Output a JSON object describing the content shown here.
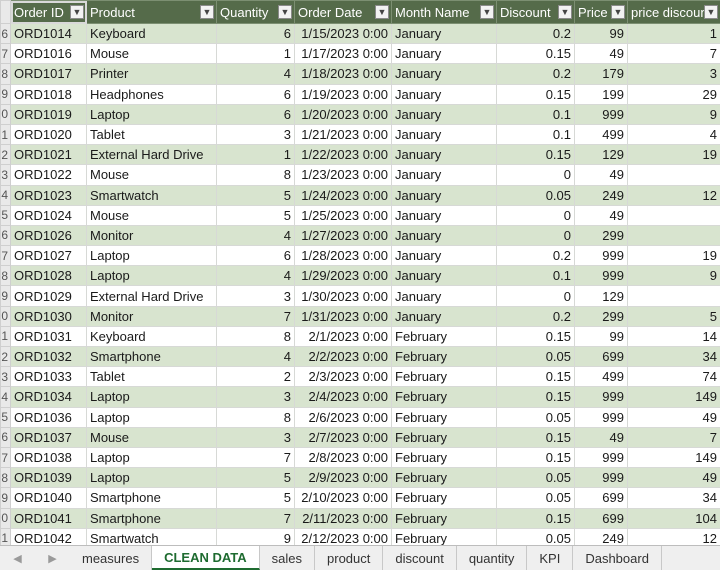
{
  "headers": [
    "Order ID",
    "Product",
    "Quantity",
    "Order Date",
    "Month Name",
    "Discount",
    "Price",
    "price discount"
  ],
  "rows": [
    {
      "rn": "6",
      "id": "ORD1014",
      "product": "Keyboard",
      "qty": "6",
      "date": "1/15/2023 0:00",
      "month": "January",
      "disc": "0.2",
      "price": "99",
      "pdisc": "1"
    },
    {
      "rn": "7",
      "id": "ORD1016",
      "product": "Mouse",
      "qty": "1",
      "date": "1/17/2023 0:00",
      "month": "January",
      "disc": "0.15",
      "price": "49",
      "pdisc": "7"
    },
    {
      "rn": "8",
      "id": "ORD1017",
      "product": "Printer",
      "qty": "4",
      "date": "1/18/2023 0:00",
      "month": "January",
      "disc": "0.2",
      "price": "179",
      "pdisc": "3"
    },
    {
      "rn": "9",
      "id": "ORD1018",
      "product": "Headphones",
      "qty": "6",
      "date": "1/19/2023 0:00",
      "month": "January",
      "disc": "0.15",
      "price": "199",
      "pdisc": "29"
    },
    {
      "rn": "0",
      "id": "ORD1019",
      "product": "Laptop",
      "qty": "6",
      "date": "1/20/2023 0:00",
      "month": "January",
      "disc": "0.1",
      "price": "999",
      "pdisc": "9"
    },
    {
      "rn": "1",
      "id": "ORD1020",
      "product": "Tablet",
      "qty": "3",
      "date": "1/21/2023 0:00",
      "month": "January",
      "disc": "0.1",
      "price": "499",
      "pdisc": "4"
    },
    {
      "rn": "2",
      "id": "ORD1021",
      "product": "External Hard Drive",
      "qty": "1",
      "date": "1/22/2023 0:00",
      "month": "January",
      "disc": "0.15",
      "price": "129",
      "pdisc": "19"
    },
    {
      "rn": "3",
      "id": "ORD1022",
      "product": "Mouse",
      "qty": "8",
      "date": "1/23/2023 0:00",
      "month": "January",
      "disc": "0",
      "price": "49",
      "pdisc": ""
    },
    {
      "rn": "4",
      "id": "ORD1023",
      "product": "Smartwatch",
      "qty": "5",
      "date": "1/24/2023 0:00",
      "month": "January",
      "disc": "0.05",
      "price": "249",
      "pdisc": "12"
    },
    {
      "rn": "5",
      "id": "ORD1024",
      "product": "Mouse",
      "qty": "5",
      "date": "1/25/2023 0:00",
      "month": "January",
      "disc": "0",
      "price": "49",
      "pdisc": ""
    },
    {
      "rn": "6",
      "id": "ORD1026",
      "product": "Monitor",
      "qty": "4",
      "date": "1/27/2023 0:00",
      "month": "January",
      "disc": "0",
      "price": "299",
      "pdisc": ""
    },
    {
      "rn": "7",
      "id": "ORD1027",
      "product": "Laptop",
      "qty": "6",
      "date": "1/28/2023 0:00",
      "month": "January",
      "disc": "0.2",
      "price": "999",
      "pdisc": "19"
    },
    {
      "rn": "8",
      "id": "ORD1028",
      "product": "Laptop",
      "qty": "4",
      "date": "1/29/2023 0:00",
      "month": "January",
      "disc": "0.1",
      "price": "999",
      "pdisc": "9"
    },
    {
      "rn": "9",
      "id": "ORD1029",
      "product": "External Hard Drive",
      "qty": "3",
      "date": "1/30/2023 0:00",
      "month": "January",
      "disc": "0",
      "price": "129",
      "pdisc": ""
    },
    {
      "rn": "0",
      "id": "ORD1030",
      "product": "Monitor",
      "qty": "7",
      "date": "1/31/2023 0:00",
      "month": "January",
      "disc": "0.2",
      "price": "299",
      "pdisc": "5"
    },
    {
      "rn": "1",
      "id": "ORD1031",
      "product": "Keyboard",
      "qty": "8",
      "date": "2/1/2023 0:00",
      "month": "February",
      "disc": "0.15",
      "price": "99",
      "pdisc": "14"
    },
    {
      "rn": "2",
      "id": "ORD1032",
      "product": "Smartphone",
      "qty": "4",
      "date": "2/2/2023 0:00",
      "month": "February",
      "disc": "0.05",
      "price": "699",
      "pdisc": "34"
    },
    {
      "rn": "3",
      "id": "ORD1033",
      "product": "Tablet",
      "qty": "2",
      "date": "2/3/2023 0:00",
      "month": "February",
      "disc": "0.15",
      "price": "499",
      "pdisc": "74"
    },
    {
      "rn": "4",
      "id": "ORD1034",
      "product": "Laptop",
      "qty": "3",
      "date": "2/4/2023 0:00",
      "month": "February",
      "disc": "0.15",
      "price": "999",
      "pdisc": "149"
    },
    {
      "rn": "5",
      "id": "ORD1036",
      "product": "Laptop",
      "qty": "8",
      "date": "2/6/2023 0:00",
      "month": "February",
      "disc": "0.05",
      "price": "999",
      "pdisc": "49"
    },
    {
      "rn": "6",
      "id": "ORD1037",
      "product": "Mouse",
      "qty": "3",
      "date": "2/7/2023 0:00",
      "month": "February",
      "disc": "0.15",
      "price": "49",
      "pdisc": "7"
    },
    {
      "rn": "7",
      "id": "ORD1038",
      "product": "Laptop",
      "qty": "7",
      "date": "2/8/2023 0:00",
      "month": "February",
      "disc": "0.15",
      "price": "999",
      "pdisc": "149"
    },
    {
      "rn": "8",
      "id": "ORD1039",
      "product": "Laptop",
      "qty": "5",
      "date": "2/9/2023 0:00",
      "month": "February",
      "disc": "0.05",
      "price": "999",
      "pdisc": "49"
    },
    {
      "rn": "9",
      "id": "ORD1040",
      "product": "Smartphone",
      "qty": "5",
      "date": "2/10/2023 0:00",
      "month": "February",
      "disc": "0.05",
      "price": "699",
      "pdisc": "34"
    },
    {
      "rn": "0",
      "id": "ORD1041",
      "product": "Smartphone",
      "qty": "7",
      "date": "2/11/2023 0:00",
      "month": "February",
      "disc": "0.15",
      "price": "699",
      "pdisc": "104"
    },
    {
      "rn": "1",
      "id": "ORD1042",
      "product": "Smartwatch",
      "qty": "9",
      "date": "2/12/2023 0:00",
      "month": "February",
      "disc": "0.05",
      "price": "249",
      "pdisc": "12"
    }
  ],
  "tabs": [
    "measures",
    "CLEAN DATA",
    "sales",
    "product",
    "discount",
    "quantity",
    "KPI",
    "Dashboard"
  ],
  "active_tab": "CLEAN DATA",
  "nav": {
    "prev": "◀",
    "next": "▶"
  },
  "colors": {
    "header": "#556b4a",
    "band": "#d8e4cf",
    "active_tab": "#1e6b30"
  }
}
